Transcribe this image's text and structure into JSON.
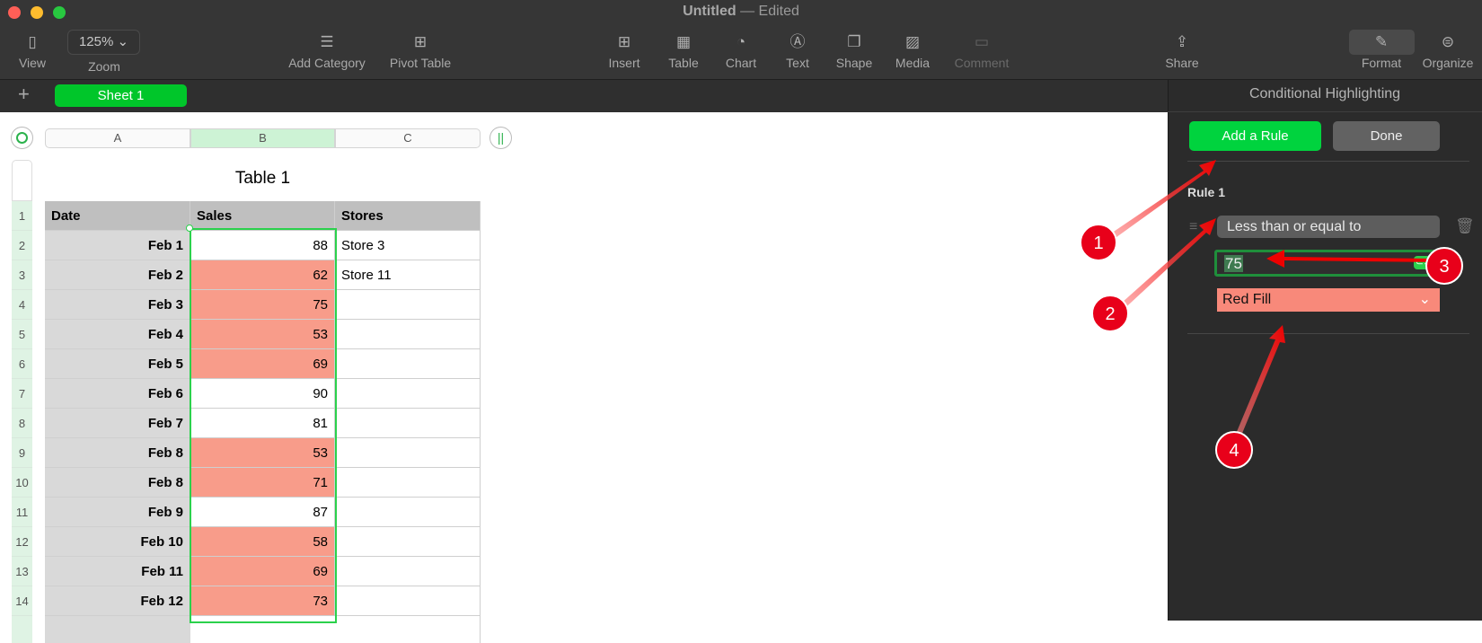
{
  "window": {
    "title": "Untitled",
    "status": "— Edited"
  },
  "toolbar": [
    {
      "id": "view",
      "label": "View",
      "icon": "sidebar-icon",
      "glyph": "▯"
    },
    {
      "id": "add-category",
      "label": "Add Category",
      "icon": "list-icon",
      "glyph": "☰"
    },
    {
      "id": "pivot-table",
      "label": "Pivot Table",
      "icon": "pivot-icon",
      "glyph": "⊞"
    },
    {
      "id": "insert",
      "label": "Insert",
      "icon": "insert-icon",
      "glyph": "⊞"
    },
    {
      "id": "table",
      "label": "Table",
      "icon": "table-icon",
      "glyph": "▦"
    },
    {
      "id": "chart",
      "label": "Chart",
      "icon": "chart-icon",
      "glyph": "◔"
    },
    {
      "id": "text",
      "label": "Text",
      "icon": "text-icon",
      "glyph": "Ⓐ"
    },
    {
      "id": "shape",
      "label": "Shape",
      "icon": "shape-icon",
      "glyph": "❐"
    },
    {
      "id": "media",
      "label": "Media",
      "icon": "media-icon",
      "glyph": "▨"
    },
    {
      "id": "comment",
      "label": "Comment",
      "icon": "comment-icon",
      "glyph": "▭"
    },
    {
      "id": "share",
      "label": "Share",
      "icon": "share-icon",
      "glyph": "⇪"
    },
    {
      "id": "format",
      "label": "Format",
      "icon": "paintbrush-icon",
      "glyph": "✎"
    },
    {
      "id": "organize",
      "label": "Organize",
      "icon": "organize-icon",
      "glyph": "⊜"
    }
  ],
  "zoom": {
    "value": "125%",
    "label": "Zoom"
  },
  "sheets": {
    "active": "Sheet 1"
  },
  "table": {
    "title": "Table 1",
    "columns": [
      "A",
      "B",
      "C"
    ],
    "headers": [
      "Date",
      "Sales",
      "Stores"
    ],
    "rows": [
      {
        "n": "1"
      },
      {
        "n": "2",
        "date": "Feb 1",
        "sales": "88",
        "store": "Store 3",
        "hl": false
      },
      {
        "n": "3",
        "date": "Feb 2",
        "sales": "62",
        "store": "Store 11",
        "hl": true
      },
      {
        "n": "4",
        "date": "Feb 3",
        "sales": "75",
        "store": "",
        "hl": true
      },
      {
        "n": "5",
        "date": "Feb 4",
        "sales": "53",
        "store": "",
        "hl": true
      },
      {
        "n": "6",
        "date": "Feb 5",
        "sales": "69",
        "store": "",
        "hl": true
      },
      {
        "n": "7",
        "date": "Feb 6",
        "sales": "90",
        "store": "",
        "hl": false
      },
      {
        "n": "8",
        "date": "Feb 7",
        "sales": "81",
        "store": "",
        "hl": false
      },
      {
        "n": "9",
        "date": "Feb 8",
        "sales": "53",
        "store": "",
        "hl": true
      },
      {
        "n": "10",
        "date": "Feb 8",
        "sales": "71",
        "store": "",
        "hl": true
      },
      {
        "n": "11",
        "date": "Feb 9",
        "sales": "87",
        "store": "",
        "hl": false
      },
      {
        "n": "12",
        "date": "Feb 10",
        "sales": "58",
        "store": "",
        "hl": true
      },
      {
        "n": "13",
        "date": "Feb 11",
        "sales": "69",
        "store": "",
        "hl": true
      },
      {
        "n": "14",
        "date": "Feb 12",
        "sales": "73",
        "store": "",
        "hl": true
      }
    ]
  },
  "panel": {
    "title": "Conditional Highlighting",
    "add_rule": "Add a Rule",
    "done": "Done",
    "rule_title": "Rule 1",
    "condition": "Less than or equal to",
    "value": "75",
    "style": "Red Fill"
  },
  "annotations": [
    "1",
    "2",
    "3",
    "4"
  ],
  "colors": {
    "accent": "#00c62a",
    "highlight": "#f89c8a",
    "red_fill": "#f8897a",
    "annotation": "#e8001a"
  }
}
